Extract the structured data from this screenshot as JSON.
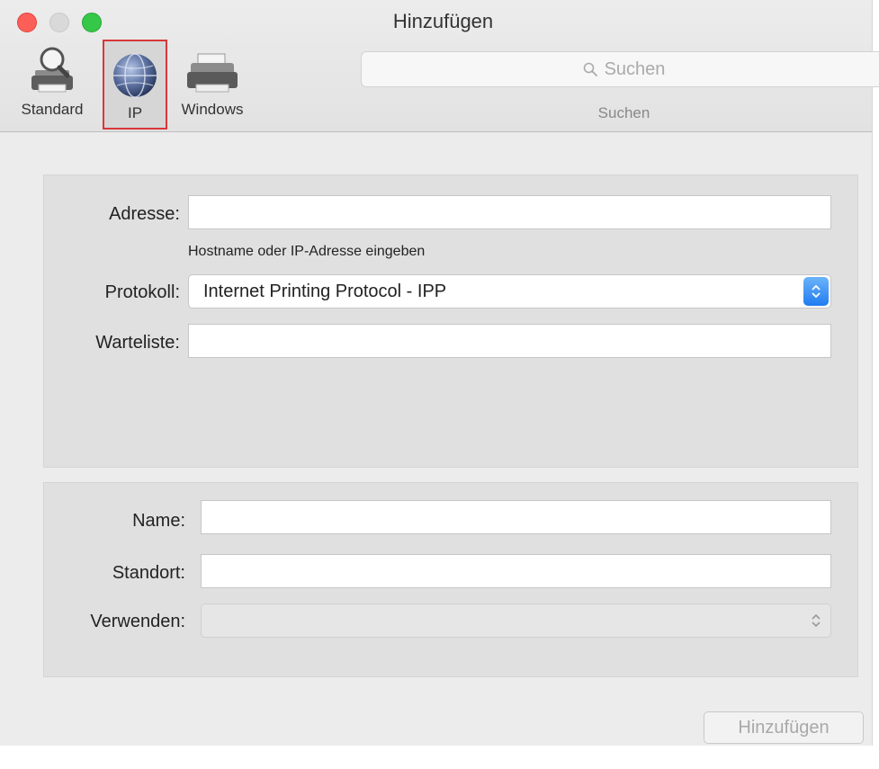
{
  "window": {
    "title": "Hinzufügen"
  },
  "toolbar": {
    "items": [
      {
        "label": "Standard",
        "icon": "printer-magnifier-icon",
        "selected": false
      },
      {
        "label": "IP",
        "icon": "globe-icon",
        "selected": true
      },
      {
        "label": "Windows",
        "icon": "printer-icon",
        "selected": false
      }
    ],
    "search": {
      "placeholder": "Suchen",
      "caption": "Suchen"
    }
  },
  "form": {
    "address": {
      "label": "Adresse:",
      "value": "",
      "hint": "Hostname oder IP-Adresse eingeben"
    },
    "protocol": {
      "label": "Protokoll:",
      "value": "Internet Printing Protocol - IPP"
    },
    "queue": {
      "label": "Warteliste:",
      "value": ""
    },
    "name": {
      "label": "Name:",
      "value": ""
    },
    "location": {
      "label": "Standort:",
      "value": ""
    },
    "use": {
      "label": "Verwenden:",
      "value": ""
    }
  },
  "actions": {
    "add_label": "Hinzufügen"
  },
  "colors": {
    "highlight_border": "#d9373b",
    "stepper_blue": "#1f7cf0"
  }
}
